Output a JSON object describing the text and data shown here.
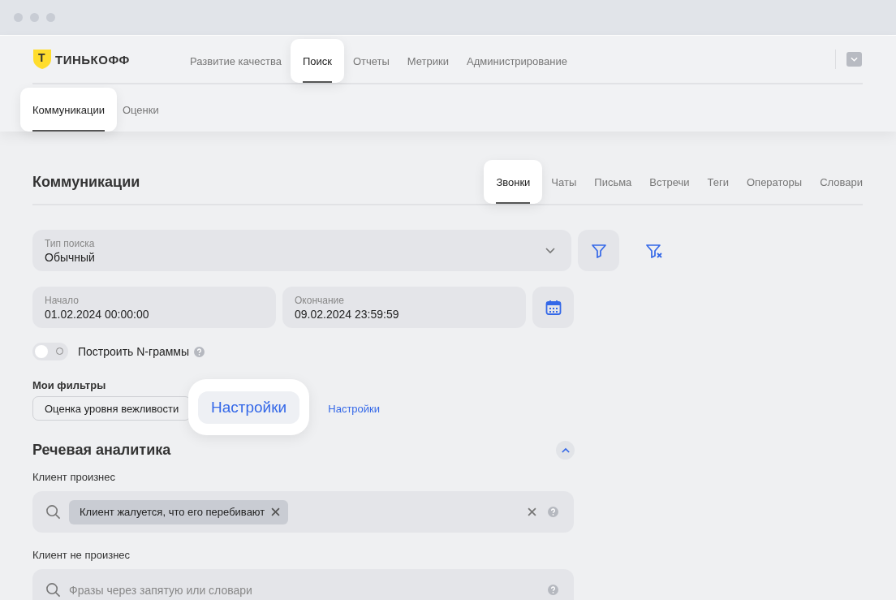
{
  "header": {
    "logo": {
      "letter": "Т",
      "name": "ТИНЬКОФФ"
    },
    "nav": [
      {
        "label": "Развитие качества",
        "selected": false
      },
      {
        "label": "Поиск",
        "selected": true
      },
      {
        "label": "Отчеты",
        "selected": false
      },
      {
        "label": "Метрики",
        "selected": false
      },
      {
        "label": "Администрирование",
        "selected": false
      }
    ],
    "subnav": [
      {
        "label": "Коммуникации",
        "selected": true
      },
      {
        "label": "Оценки",
        "selected": false
      }
    ]
  },
  "page": {
    "title": "Коммуникации",
    "tabs": [
      {
        "label": "Звонки",
        "selected": true
      },
      {
        "label": "Чаты",
        "selected": false
      },
      {
        "label": "Письма",
        "selected": false
      },
      {
        "label": "Встречи",
        "selected": false
      },
      {
        "label": "Теги",
        "selected": false
      },
      {
        "label": "Операторы",
        "selected": false
      },
      {
        "label": "Словари",
        "selected": false
      }
    ]
  },
  "search_type": {
    "label": "Тип поиска",
    "value": "Обычный"
  },
  "period": {
    "start": {
      "label": "Начало",
      "value": "01.02.2024 00:00:00"
    },
    "end": {
      "label": "Окончание",
      "value": "09.02.2024 23:59:59"
    }
  },
  "ngrams": {
    "label": "Построить N-граммы",
    "on": false
  },
  "my_filters": {
    "title": "Мои фильтры",
    "chips": [
      "Оценка уровня вежливости"
    ],
    "callout": "Настройки",
    "link": "Настройки"
  },
  "speech": {
    "title": "Речевая аналитика",
    "expanded": true,
    "said": {
      "label": "Клиент произнес",
      "tags": [
        "Клиент жалуется, что его перебивают"
      ]
    },
    "not_said": {
      "label": "Клиент не произнес",
      "placeholder": "Фразы через запятую или словари"
    }
  }
}
